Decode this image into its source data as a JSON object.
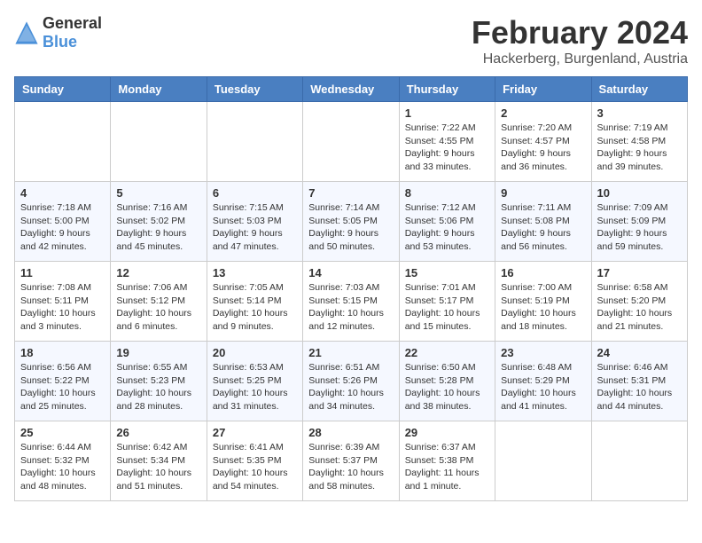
{
  "logo": {
    "general": "General",
    "blue": "Blue"
  },
  "title": "February 2024",
  "subtitle": "Hackerberg, Burgenland, Austria",
  "days_of_week": [
    "Sunday",
    "Monday",
    "Tuesday",
    "Wednesday",
    "Thursday",
    "Friday",
    "Saturday"
  ],
  "weeks": [
    [
      {
        "day": "",
        "info": ""
      },
      {
        "day": "",
        "info": ""
      },
      {
        "day": "",
        "info": ""
      },
      {
        "day": "",
        "info": ""
      },
      {
        "day": "1",
        "info": "Sunrise: 7:22 AM\nSunset: 4:55 PM\nDaylight: 9 hours\nand 33 minutes."
      },
      {
        "day": "2",
        "info": "Sunrise: 7:20 AM\nSunset: 4:57 PM\nDaylight: 9 hours\nand 36 minutes."
      },
      {
        "day": "3",
        "info": "Sunrise: 7:19 AM\nSunset: 4:58 PM\nDaylight: 9 hours\nand 39 minutes."
      }
    ],
    [
      {
        "day": "4",
        "info": "Sunrise: 7:18 AM\nSunset: 5:00 PM\nDaylight: 9 hours\nand 42 minutes."
      },
      {
        "day": "5",
        "info": "Sunrise: 7:16 AM\nSunset: 5:02 PM\nDaylight: 9 hours\nand 45 minutes."
      },
      {
        "day": "6",
        "info": "Sunrise: 7:15 AM\nSunset: 5:03 PM\nDaylight: 9 hours\nand 47 minutes."
      },
      {
        "day": "7",
        "info": "Sunrise: 7:14 AM\nSunset: 5:05 PM\nDaylight: 9 hours\nand 50 minutes."
      },
      {
        "day": "8",
        "info": "Sunrise: 7:12 AM\nSunset: 5:06 PM\nDaylight: 9 hours\nand 53 minutes."
      },
      {
        "day": "9",
        "info": "Sunrise: 7:11 AM\nSunset: 5:08 PM\nDaylight: 9 hours\nand 56 minutes."
      },
      {
        "day": "10",
        "info": "Sunrise: 7:09 AM\nSunset: 5:09 PM\nDaylight: 9 hours\nand 59 minutes."
      }
    ],
    [
      {
        "day": "11",
        "info": "Sunrise: 7:08 AM\nSunset: 5:11 PM\nDaylight: 10 hours\nand 3 minutes."
      },
      {
        "day": "12",
        "info": "Sunrise: 7:06 AM\nSunset: 5:12 PM\nDaylight: 10 hours\nand 6 minutes."
      },
      {
        "day": "13",
        "info": "Sunrise: 7:05 AM\nSunset: 5:14 PM\nDaylight: 10 hours\nand 9 minutes."
      },
      {
        "day": "14",
        "info": "Sunrise: 7:03 AM\nSunset: 5:15 PM\nDaylight: 10 hours\nand 12 minutes."
      },
      {
        "day": "15",
        "info": "Sunrise: 7:01 AM\nSunset: 5:17 PM\nDaylight: 10 hours\nand 15 minutes."
      },
      {
        "day": "16",
        "info": "Sunrise: 7:00 AM\nSunset: 5:19 PM\nDaylight: 10 hours\nand 18 minutes."
      },
      {
        "day": "17",
        "info": "Sunrise: 6:58 AM\nSunset: 5:20 PM\nDaylight: 10 hours\nand 21 minutes."
      }
    ],
    [
      {
        "day": "18",
        "info": "Sunrise: 6:56 AM\nSunset: 5:22 PM\nDaylight: 10 hours\nand 25 minutes."
      },
      {
        "day": "19",
        "info": "Sunrise: 6:55 AM\nSunset: 5:23 PM\nDaylight: 10 hours\nand 28 minutes."
      },
      {
        "day": "20",
        "info": "Sunrise: 6:53 AM\nSunset: 5:25 PM\nDaylight: 10 hours\nand 31 minutes."
      },
      {
        "day": "21",
        "info": "Sunrise: 6:51 AM\nSunset: 5:26 PM\nDaylight: 10 hours\nand 34 minutes."
      },
      {
        "day": "22",
        "info": "Sunrise: 6:50 AM\nSunset: 5:28 PM\nDaylight: 10 hours\nand 38 minutes."
      },
      {
        "day": "23",
        "info": "Sunrise: 6:48 AM\nSunset: 5:29 PM\nDaylight: 10 hours\nand 41 minutes."
      },
      {
        "day": "24",
        "info": "Sunrise: 6:46 AM\nSunset: 5:31 PM\nDaylight: 10 hours\nand 44 minutes."
      }
    ],
    [
      {
        "day": "25",
        "info": "Sunrise: 6:44 AM\nSunset: 5:32 PM\nDaylight: 10 hours\nand 48 minutes."
      },
      {
        "day": "26",
        "info": "Sunrise: 6:42 AM\nSunset: 5:34 PM\nDaylight: 10 hours\nand 51 minutes."
      },
      {
        "day": "27",
        "info": "Sunrise: 6:41 AM\nSunset: 5:35 PM\nDaylight: 10 hours\nand 54 minutes."
      },
      {
        "day": "28",
        "info": "Sunrise: 6:39 AM\nSunset: 5:37 PM\nDaylight: 10 hours\nand 58 minutes."
      },
      {
        "day": "29",
        "info": "Sunrise: 6:37 AM\nSunset: 5:38 PM\nDaylight: 11 hours\nand 1 minute."
      },
      {
        "day": "",
        "info": ""
      },
      {
        "day": "",
        "info": ""
      }
    ]
  ]
}
